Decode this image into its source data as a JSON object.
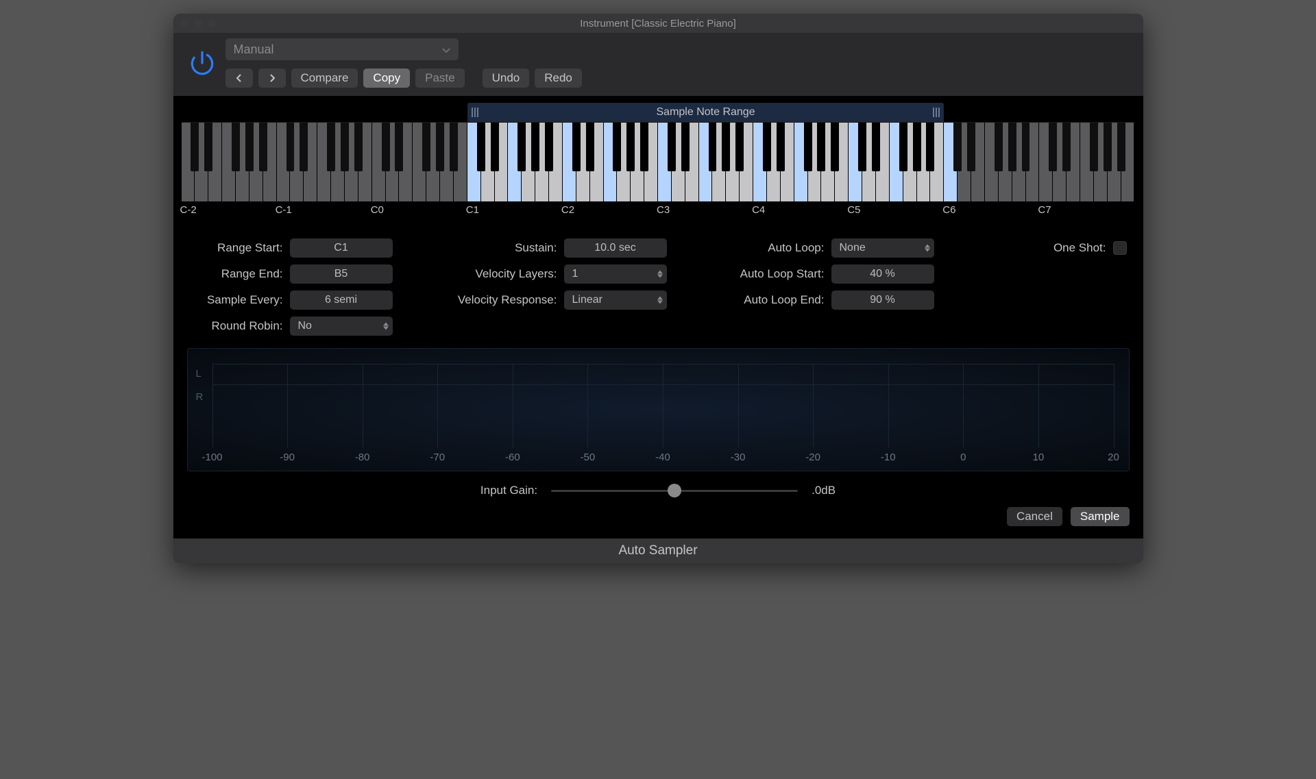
{
  "window_title": "Instrument [Classic Electric Piano]",
  "footer_title": "Auto Sampler",
  "preset": "Manual",
  "toolbar": {
    "compare": "Compare",
    "copy": "Copy",
    "paste": "Paste",
    "undo": "Undo",
    "redo": "Redo"
  },
  "range_header": "Sample Note Range",
  "octave_labels": [
    "C-2",
    "C-1",
    "C0",
    "C1",
    "C2",
    "C3",
    "C4",
    "C5",
    "C6",
    "C7"
  ],
  "params": {
    "range_start": {
      "label": "Range Start:",
      "value": "C1"
    },
    "range_end": {
      "label": "Range End:",
      "value": "B5"
    },
    "sample_every": {
      "label": "Sample Every:",
      "value": "6 semi"
    },
    "round_robin": {
      "label": "Round Robin:",
      "value": "No"
    },
    "sustain": {
      "label": "Sustain:",
      "value": "10.0 sec"
    },
    "velocity_layers": {
      "label": "Velocity Layers:",
      "value": "1"
    },
    "velocity_response": {
      "label": "Velocity Response:",
      "value": "Linear"
    },
    "auto_loop": {
      "label": "Auto Loop:",
      "value": "None"
    },
    "auto_loop_start": {
      "label": "Auto Loop Start:",
      "value": "40 %"
    },
    "auto_loop_end": {
      "label": "Auto Loop End:",
      "value": "90 %"
    },
    "one_shot": {
      "label": "One Shot:"
    }
  },
  "meter": {
    "channels": [
      "L",
      "R"
    ],
    "scale": [
      "-100",
      "-90",
      "-80",
      "-70",
      "-60",
      "-50",
      "-40",
      "-30",
      "-20",
      "-10",
      "0",
      "10",
      "20"
    ]
  },
  "input_gain": {
    "label": "Input Gain:",
    "value": ".0dB"
  },
  "actions": {
    "cancel": "Cancel",
    "sample": "Sample"
  },
  "keyboard": {
    "total_white_keys": 70,
    "range_start_white_idx": 21,
    "range_end_white_idx": 55,
    "highlight_white_idx": [
      21,
      24,
      28,
      31,
      35,
      38,
      42,
      45,
      49,
      52,
      56
    ]
  }
}
